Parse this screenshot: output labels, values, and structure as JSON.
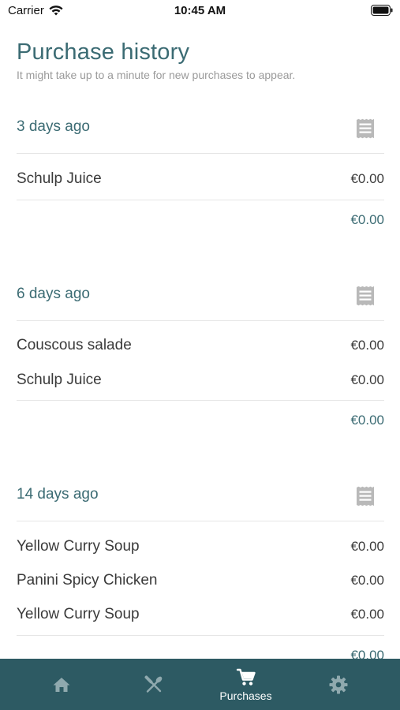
{
  "status_bar": {
    "carrier": "Carrier",
    "time": "10:45 AM"
  },
  "header": {
    "title": "Purchase history",
    "subtitle": "It might take up to a minute for new purchases to appear."
  },
  "purchases": [
    {
      "date": "3 days ago",
      "items": [
        {
          "name": "Schulp Juice",
          "price": "€0.00"
        }
      ],
      "total": "€0.00"
    },
    {
      "date": "6 days ago",
      "items": [
        {
          "name": "Couscous salade",
          "price": "€0.00"
        },
        {
          "name": "Schulp Juice",
          "price": "€0.00"
        }
      ],
      "total": "€0.00"
    },
    {
      "date": "14 days ago",
      "items": [
        {
          "name": "Yellow Curry Soup",
          "price": "€0.00"
        },
        {
          "name": "Panini Spicy Chicken",
          "price": "€0.00"
        },
        {
          "name": "Yellow Curry Soup",
          "price": "€0.00"
        }
      ],
      "total": "€0.00"
    }
  ],
  "tab_bar": {
    "tabs": [
      {
        "icon": "home-icon",
        "label": "",
        "active": false
      },
      {
        "icon": "utensils-icon",
        "label": "",
        "active": false
      },
      {
        "icon": "cart-icon",
        "label": "Purchases",
        "active": true
      },
      {
        "icon": "gear-icon",
        "label": "",
        "active": false
      }
    ],
    "active_color": "#ffffff",
    "inactive_color": "#8fa9ae",
    "background": "#2d5a63"
  },
  "colors": {
    "accent": "#3b6b73",
    "text": "#3a3a3a",
    "subtle": "#9a9a9a"
  }
}
